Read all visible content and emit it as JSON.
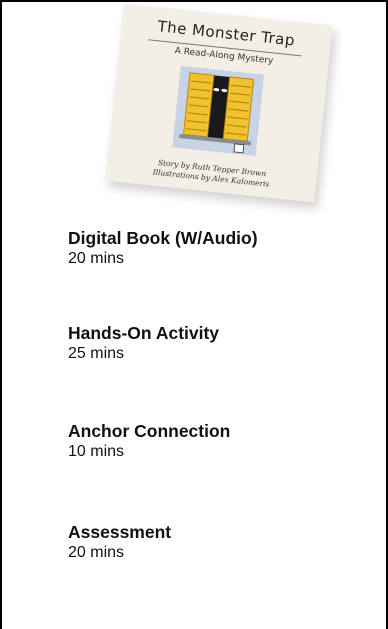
{
  "book": {
    "title": "The Monster Trap",
    "subtitle": "A Read-Along Mystery",
    "credit_story": "Story by Ruth Tepper Brown",
    "credit_illustrations": "Illustrations by Alex Kalomeris"
  },
  "activities": [
    {
      "title": "Digital Book (W/Audio)",
      "duration": "20 mins"
    },
    {
      "title": "Hands-On Activity",
      "duration": "25 mins"
    },
    {
      "title": "Anchor Connection",
      "duration": "10 mins"
    },
    {
      "title": "Assessment",
      "duration": "20 mins"
    }
  ],
  "colors": {
    "shutter": "#f2c12e",
    "shutter_dark": "#b78a12",
    "window_bg": "#c9d3e6",
    "frame_border": "#000000"
  }
}
